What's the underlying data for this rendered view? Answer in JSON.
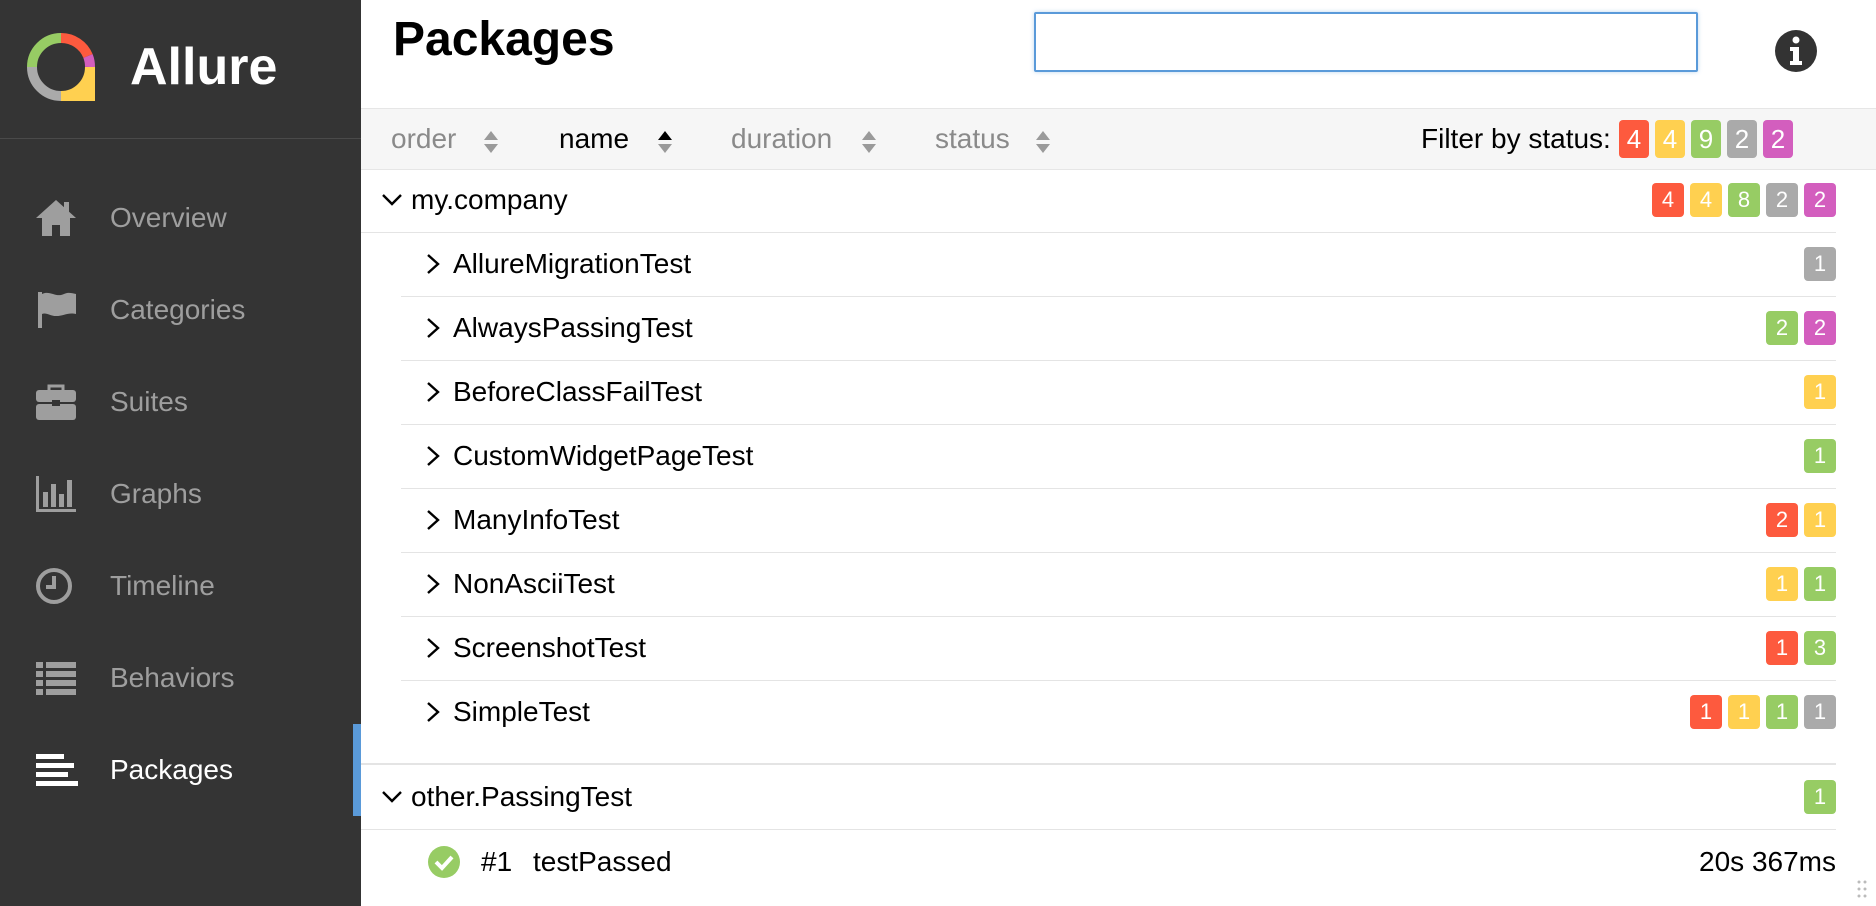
{
  "brand": {
    "name": "Allure"
  },
  "sidebar": {
    "items": [
      {
        "label": "Overview",
        "icon": "home-icon"
      },
      {
        "label": "Categories",
        "icon": "flag-icon"
      },
      {
        "label": "Suites",
        "icon": "briefcase-icon"
      },
      {
        "label": "Graphs",
        "icon": "bar-chart-icon"
      },
      {
        "label": "Timeline",
        "icon": "clock-icon"
      },
      {
        "label": "Behaviors",
        "icon": "list-icon"
      },
      {
        "label": "Packages",
        "icon": "align-left-icon",
        "active": true
      }
    ]
  },
  "main": {
    "title": "Packages",
    "search": {
      "value": "",
      "placeholder": ""
    },
    "sort": {
      "columns": [
        "order",
        "name",
        "duration",
        "status"
      ],
      "active": "name"
    },
    "filter": {
      "label": "Filter by status:",
      "counts": {
        "failed": "4",
        "broken": "4",
        "passed": "9",
        "skipped": "2",
        "unknown": "2"
      }
    },
    "groups": [
      {
        "name": "my.company",
        "expanded": true,
        "counts": [
          "4",
          "4",
          "8",
          "2",
          "2"
        ],
        "children": [
          {
            "name": "AllureMigrationTest",
            "counts": [
              "1"
            ]
          },
          {
            "name": "AlwaysPassingTest",
            "counts": [
              "2",
              "2"
            ]
          },
          {
            "name": "BeforeClassFailTest",
            "counts": [
              "1"
            ]
          },
          {
            "name": "CustomWidgetPageTest",
            "counts": [
              "1"
            ]
          },
          {
            "name": "ManyInfoTest",
            "counts": [
              "2",
              "1"
            ]
          },
          {
            "name": "NonAsciiTest",
            "counts": [
              "1",
              "1"
            ]
          },
          {
            "name": "ScreenshotTest",
            "counts": [
              "1",
              "3"
            ]
          },
          {
            "name": "SimpleTest",
            "counts": [
              "1",
              "1",
              "1",
              "1"
            ]
          }
        ]
      },
      {
        "name": "other.PassingTest",
        "expanded": true,
        "counts": [
          "1"
        ],
        "children": [
          {
            "order": "#1",
            "name": "testPassed",
            "duration": "20s 367ms",
            "status": "passed"
          }
        ]
      }
    ]
  },
  "colors": {
    "failed": "#fd5a3e",
    "broken": "#ffd050",
    "passed": "#97cc64",
    "skipped": "#aaaaaa",
    "unknown": "#d35ebe",
    "sidebar_bg": "#343434",
    "accent": "#5a9ad9"
  }
}
